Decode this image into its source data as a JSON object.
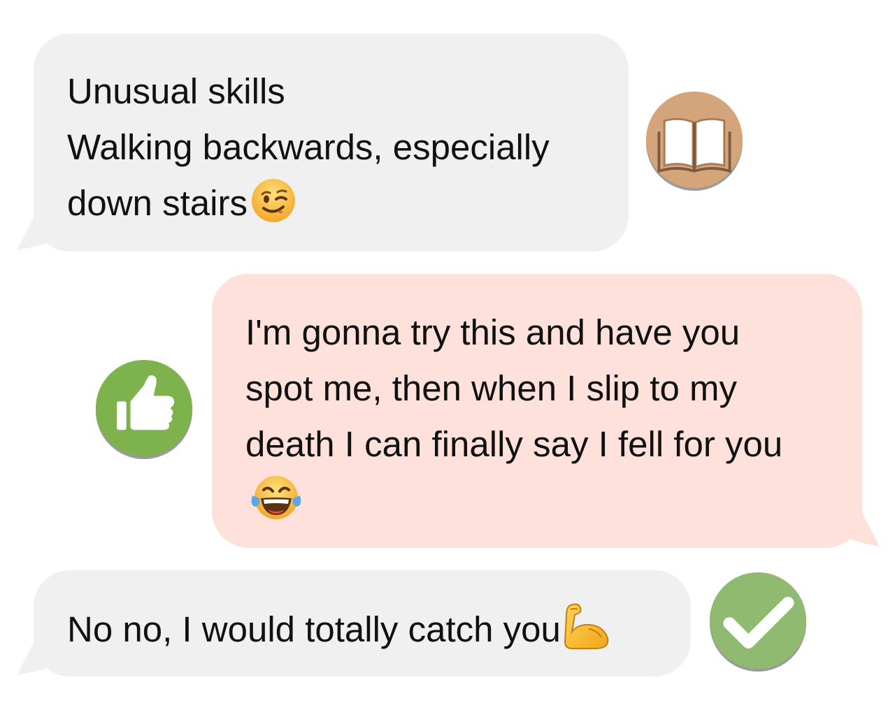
{
  "messages": [
    {
      "side": "incoming",
      "lines": [
        "Unusual skills",
        "Walking backwards, especially",
        "down stairs"
      ],
      "emoji": "winking-face",
      "reaction_icon": "open-book-icon",
      "bubble_color": "#f0f0f0",
      "reaction_color": "#d4a47a"
    },
    {
      "side": "outgoing",
      "lines": [
        "I'm gonna try this and have you",
        "spot me, then when I slip to my",
        "death I can finally say I fell for you"
      ],
      "emoji": "face-with-tears-of-joy",
      "reaction_icon": "thumbs-up-icon",
      "bubble_color": "#fde1da",
      "reaction_color": "#7db24d"
    },
    {
      "side": "incoming",
      "lines": [
        "No no, I would totally catch you"
      ],
      "emoji": "flexed-biceps",
      "reaction_icon": "checkmark-icon",
      "bubble_color": "#f0f0f0",
      "reaction_color": "#8fba6f"
    }
  ]
}
